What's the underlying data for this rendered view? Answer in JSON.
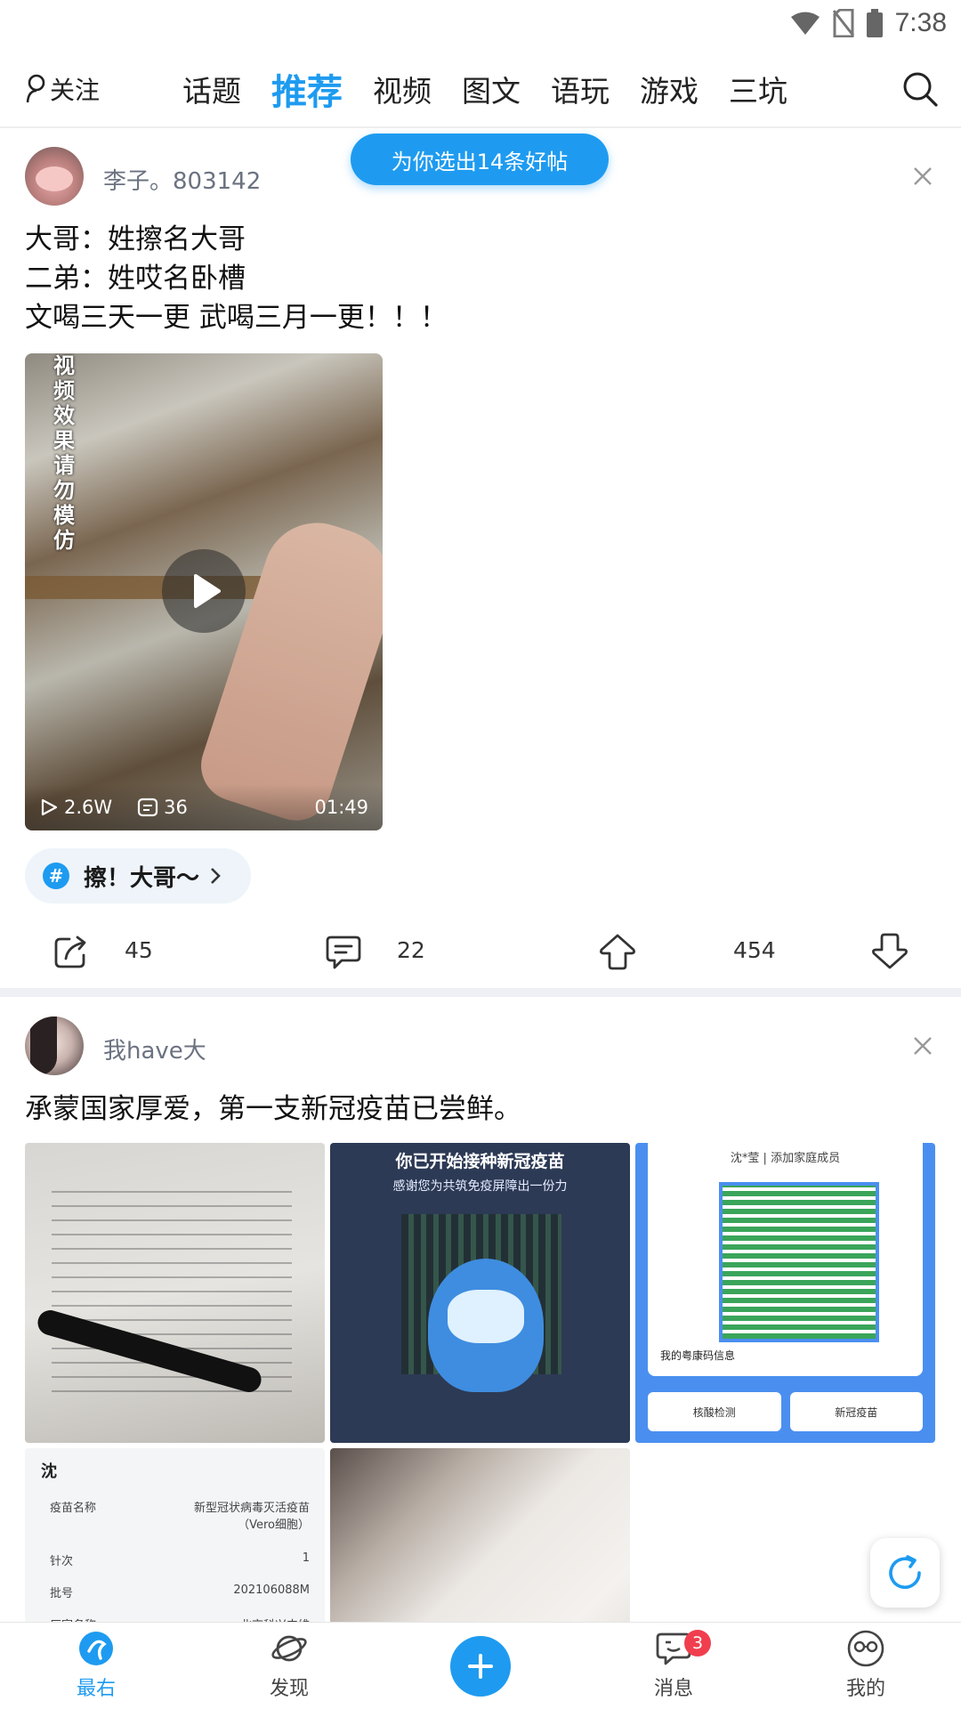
{
  "status_bar": {
    "time": "7:38"
  },
  "top_nav": {
    "follow_label": "关注",
    "tabs": [
      {
        "label": "话题",
        "active": false
      },
      {
        "label": "推荐",
        "active": true
      },
      {
        "label": "视频",
        "active": false
      },
      {
        "label": "图文",
        "active": false
      },
      {
        "label": "语玩",
        "active": false
      },
      {
        "label": "游戏",
        "active": false
      },
      {
        "label": "三坑",
        "active": false
      }
    ]
  },
  "toast": "为你选出14条好帖",
  "post1": {
    "username": "李子。803142",
    "lines": [
      "大哥：姓擦名大哥",
      "二弟：姓哎名卧槽",
      "文喝三天一更 武喝三月一更！！！"
    ],
    "video": {
      "caption": "视频效果 请勿模仿",
      "plays": "2.6W",
      "comments": "36",
      "duration": "01:49"
    },
    "topic": "擦！大哥～",
    "actions": {
      "shares": "45",
      "comments": "22",
      "upvotes": "454"
    }
  },
  "post2": {
    "username": "我have大",
    "text": "承蒙国家厚爱，第一支新冠疫苗已尝鲜。",
    "images": {
      "img2_title": "你已开始接种新冠疫苗",
      "img2_sub": "感谢您为共筑免疫屏障出一份力",
      "img3_header": "沈*莹 | 添加家庭成员",
      "img3_info": "我的粤康码信息",
      "img3_btn1": "核酸检测",
      "img3_btn2": "新冠疫苗",
      "img4_name": "沈",
      "img4_rows": [
        {
          "k": "疫苗名称",
          "v": "新型冠状病毒灭活疫苗（Vero细胞）"
        },
        {
          "k": "针次",
          "v": "1"
        },
        {
          "k": "批号",
          "v": "202106088M"
        },
        {
          "k": "厂家名称",
          "v": "北京科兴中维"
        }
      ]
    }
  },
  "tabbar": {
    "items": [
      {
        "label": "最右",
        "active": true
      },
      {
        "label": "发现",
        "active": false
      },
      {
        "label": "消息",
        "active": false,
        "badge": "3"
      },
      {
        "label": "我的",
        "active": false
      }
    ]
  },
  "colors": {
    "accent": "#1e9bf0",
    "badge": "#f03e4e"
  }
}
